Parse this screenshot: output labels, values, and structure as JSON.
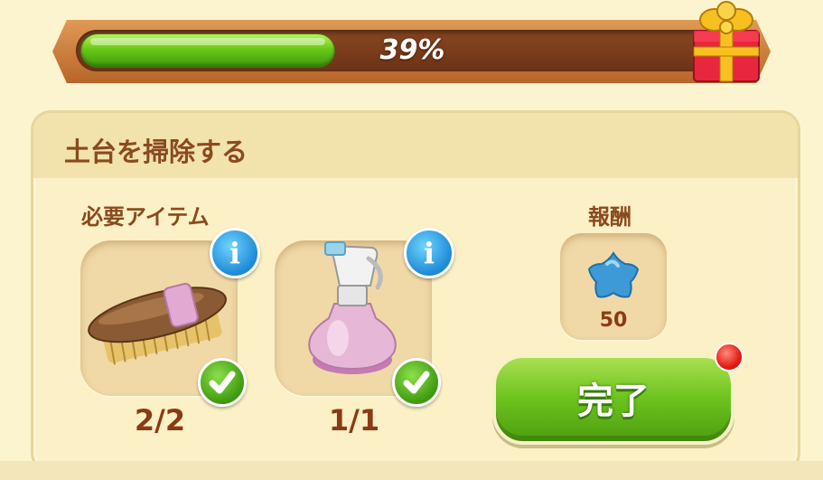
{
  "progress": {
    "percent_text": "39%",
    "fill_fraction": 0.39,
    "fill_color": "#5cc21a"
  },
  "task": {
    "title": "土台を掃除する",
    "required_items_label": "必要アイテム",
    "items": [
      {
        "name": "brush-icon",
        "count": "2/2",
        "complete": true
      },
      {
        "name": "spray-bottle-icon",
        "count": "1/1",
        "complete": true
      }
    ]
  },
  "reward": {
    "label": "報酬",
    "icon": "blue-star-icon",
    "value": "50"
  },
  "complete_button": {
    "label": "完了",
    "color": "#6cc21c"
  },
  "gift_icon": "gift-box-icon"
}
